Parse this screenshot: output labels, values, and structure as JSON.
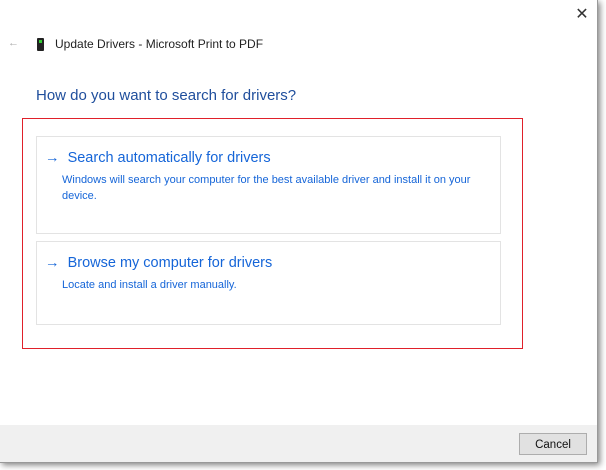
{
  "window": {
    "title": "Update Drivers - Microsoft Print to PDF",
    "close_glyph": "✕",
    "back_glyph": "←"
  },
  "heading": "How do you want to search for drivers?",
  "options": [
    {
      "arrow": "→",
      "title": "Search automatically for drivers",
      "description": "Windows will search your computer for the best available driver and install it on your device."
    },
    {
      "arrow": "→",
      "title": "Browse my computer for drivers",
      "description": "Locate and install a driver manually."
    }
  ],
  "footer": {
    "cancel_label": "Cancel"
  },
  "colors": {
    "accent": "#1565d8",
    "heading": "#1f4e9c",
    "highlight": "#e0202a"
  }
}
